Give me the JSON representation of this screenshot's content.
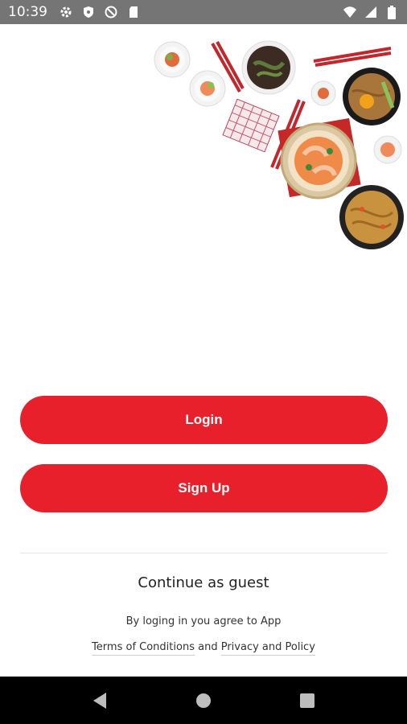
{
  "status_bar": {
    "time": "10:39",
    "left_icons": [
      "gear-icon",
      "shield-icon",
      "no-tracking-icon",
      "sd-card-icon"
    ],
    "right_icons": [
      "wifi-icon",
      "cellular-icon",
      "battery-icon"
    ]
  },
  "hero": {
    "icon": "food-dishes-illustration"
  },
  "actions": {
    "login_label": "Login",
    "signup_label": "Sign Up",
    "guest_label": "Continue as guest"
  },
  "legal": {
    "agree_text": "By loging in you agree to App",
    "terms_label": "Terms of Conditions",
    "and_text": "and",
    "privacy_label": "Privacy and Policy"
  },
  "colors": {
    "accent": "#e8202c",
    "status_bar": "#757575",
    "nav_bar": "#000000"
  },
  "nav_bar": {
    "icons": [
      "back-icon",
      "home-icon",
      "recents-icon"
    ]
  }
}
